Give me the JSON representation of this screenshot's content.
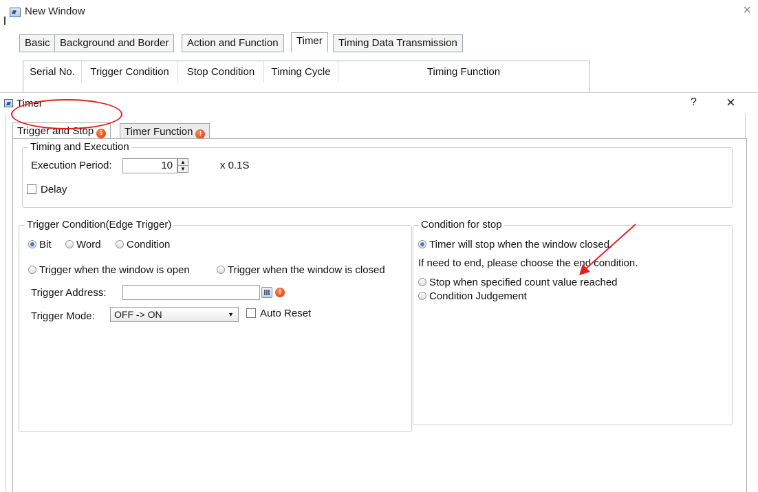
{
  "outer_window": {
    "title": "New Window",
    "close": "×",
    "tabs": [
      {
        "label": "Basic"
      },
      {
        "label": "Background and Border"
      },
      {
        "label": "Action and Function"
      },
      {
        "label": "Timer",
        "active": true
      },
      {
        "label": "Timing Data Transmission"
      }
    ],
    "table": {
      "columns": [
        "Serial No.",
        "Trigger Condition",
        "Stop Condition",
        "Timing Cycle",
        "Timing Function"
      ]
    }
  },
  "dialog": {
    "title": "Timer",
    "help": "?",
    "close": "×",
    "tabs": [
      {
        "label": "Trigger and Stop",
        "active": true,
        "warning": true
      },
      {
        "label": "Timer Function",
        "warning": true
      }
    ],
    "timing_group": {
      "title": "Timing and Execution",
      "execution_period_label": "Execution Period:",
      "execution_period_value": "10",
      "unit": "x 0.1S",
      "delay_label": "Delay",
      "delay_checked": false
    },
    "trigger_group": {
      "title": "Trigger Condition(Edge Trigger)",
      "type_options": [
        {
          "label": "Bit",
          "selected": true
        },
        {
          "label": "Word",
          "selected": false
        },
        {
          "label": "Condition",
          "selected": false
        }
      ],
      "window_options": [
        {
          "label": "Trigger when the window is open",
          "selected": false
        },
        {
          "label": "Trigger when the window is closed",
          "selected": false
        }
      ],
      "address_label": "Trigger Address:",
      "address_value": "",
      "mode_label": "Trigger Mode:",
      "mode_value": "OFF -> ON",
      "auto_reset_label": "Auto Reset",
      "auto_reset_checked": false
    },
    "stop_group": {
      "title": "Condition for stop",
      "options": [
        {
          "label": "Timer will stop when the window closed.",
          "selected": true
        },
        {
          "label": "Stop when specified count value reached",
          "selected": false
        },
        {
          "label": "Condition Judgement",
          "selected": false
        }
      ],
      "hint": "If need to end, please choose the end condition."
    }
  },
  "annotations": {
    "highlight_color": "#e02020"
  }
}
